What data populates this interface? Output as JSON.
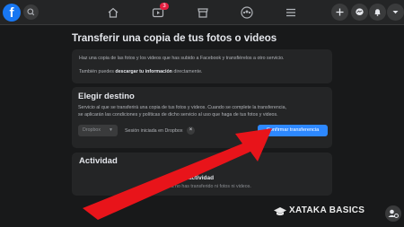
{
  "nav": {
    "logo_text": "f",
    "icons": [
      "search-icon",
      "home-icon",
      "video-icon",
      "marketplace-icon",
      "groups-icon",
      "menu-icon",
      "plus-icon",
      "messenger-icon",
      "notifications-icon",
      "chevron-down-icon"
    ],
    "video_badge": "3"
  },
  "page": {
    "title": "Transferir una copia de tus fotos o videos"
  },
  "intro": {
    "line1": "Haz una copia de las fotos y los videos que has subido a Facebook y transfiérelos a otro servicio.",
    "line2_prefix": "También puedes ",
    "line2_link": "descargar tu información",
    "line2_suffix": " directamente."
  },
  "destination": {
    "heading": "Elegir destino",
    "desc1": "Servicio al que se transferirá una copia de tus fotos y videos. Cuando se complete la transferencia,",
    "desc2": "se aplicarán las condiciones y políticas de dicho servicio al uso que haga de tus fotos y videos.",
    "selected_service": "Dropbox",
    "session_text": "Sesión iniciada en Dropbox",
    "clear_symbol": "×",
    "confirm_label": "Confirmar transferencia"
  },
  "activity": {
    "heading": "Actividad",
    "empty_title": "Sin actividad",
    "empty_desc": "Todavía no has transferido ni fotos ni videos."
  },
  "watermark": {
    "text": "XATAKA BASICS"
  },
  "colors": {
    "background": "#18191a",
    "card": "#242526",
    "accent": "#2d88ff",
    "arrow": "#e8141a",
    "badge": "#e41e3f"
  }
}
